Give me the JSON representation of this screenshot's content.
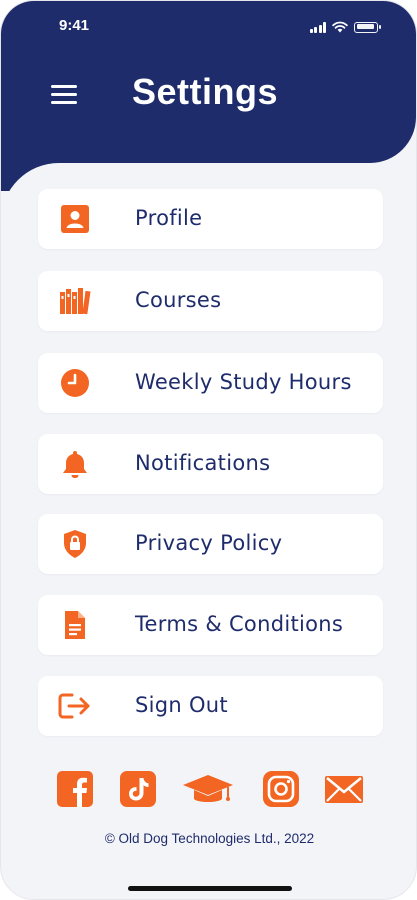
{
  "status_bar": {
    "time": "9:41"
  },
  "header": {
    "title": "Settings"
  },
  "menu": {
    "items": [
      {
        "label": "Profile",
        "icon": "profile-icon"
      },
      {
        "label": "Courses",
        "icon": "books-icon"
      },
      {
        "label": "Weekly Study Hours",
        "icon": "clock-icon"
      },
      {
        "label": "Notifications",
        "icon": "bell-icon"
      },
      {
        "label": "Privacy Policy",
        "icon": "shield-lock-icon"
      },
      {
        "label": "Terms & Conditions",
        "icon": "document-icon"
      },
      {
        "label": "Sign Out",
        "icon": "sign-out-icon"
      }
    ]
  },
  "social": [
    "facebook-icon",
    "tiktok-icon",
    "graduation-cap-icon",
    "instagram-icon",
    "mail-icon"
  ],
  "footer": {
    "copyright": "© Old Dog Technologies Ltd., 2022"
  },
  "colors": {
    "header": "#1f2c6c",
    "accent": "#f26522",
    "background": "#f3f4f8",
    "text": "#1f2c6c"
  }
}
